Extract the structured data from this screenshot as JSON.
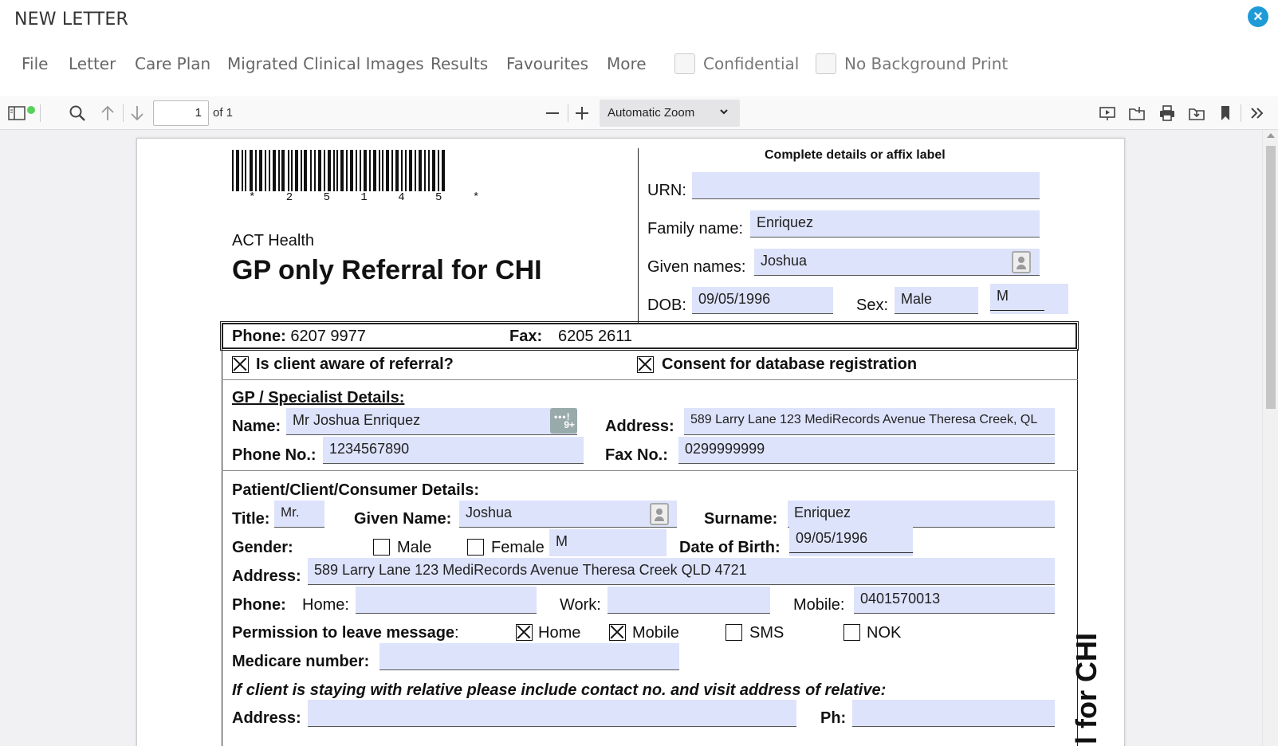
{
  "window": {
    "title": "NEW LETTER"
  },
  "menu": {
    "items": [
      "File",
      "Letter",
      "Care Plan",
      "Migrated Clinical Images",
      "Results",
      "Favourites",
      "More"
    ],
    "confidential_label": "Confidential",
    "no_bg_print_label": "No Background Print"
  },
  "pdf_toolbar": {
    "page_current": "1",
    "page_of": "of 1",
    "zoom": "Automatic Zoom"
  },
  "doc": {
    "barcode_text": "* 2 5 1 4 5 *",
    "org": "ACT Health",
    "title": "GP only Referral for CHI",
    "vertical_title": "l for CHI",
    "label_heading": "Complete details or affix label",
    "urn_label": "URN:",
    "urn_value": "",
    "family_name_label": "Family name:",
    "family_name_value": "Enriquez",
    "given_names_label": "Given names:",
    "given_names_value": "Joshua",
    "dob_label": "DOB:",
    "dob_value": "09/05/1996",
    "sex_label": "Sex:",
    "sex_value": "Male",
    "sex_code": "M",
    "phone_label": "Phone:",
    "phone_value": "6207 9977",
    "fax_label": "Fax:",
    "fax_value": "6205 2611",
    "aware_label": "Is client aware of referral?",
    "consent_label": "Consent for database registration",
    "gp_heading": "GP / Specialist Details:",
    "gp_name_label": "Name:",
    "gp_name_value": "Mr Joshua Enriquez",
    "gp_badge": "9+",
    "gp_address_label": "Address:",
    "gp_address_value": "589 Larry Lane 123 MediRecords Avenue Theresa Creek, QL",
    "gp_phone_label": "Phone No.:",
    "gp_phone_value": "1234567890",
    "gp_fax_label": "Fax No.:",
    "gp_fax_value": "0299999999",
    "patient_heading": "Patient/Client/Consumer Details:",
    "title_label": "Title:",
    "title_value": "Mr.",
    "given_name_label": "Given Name:",
    "given_name_value": "Joshua",
    "surname_label": "Surname:",
    "surname_value": "Enriquez",
    "gender_label": "Gender:",
    "male_label": "Male",
    "female_label": "Female",
    "gender_value": "M",
    "dob2_label": "Date of Birth:",
    "dob2_value": "09/05/1996",
    "address_label": "Address:",
    "address_value": "589 Larry Lane 123 MediRecords Avenue Theresa Creek QLD 4721",
    "phone2_label": "Phone:",
    "home_label": "Home:",
    "home_value": "",
    "work_label": "Work:",
    "work_value": "",
    "mobile_label": "Mobile:",
    "mobile_value": "0401570013",
    "permission_label": "Permission to leave message",
    "perm_colon": ":",
    "perm_home": "Home",
    "perm_mobile": "Mobile",
    "perm_sms": "SMS",
    "perm_nok": "NOK",
    "medicare_label": "Medicare number:",
    "medicare_value": "",
    "relative_note": "If client is staying with relative please include contact no. and visit address of relative:",
    "rel_address_label": "Address:",
    "rel_address_value": "",
    "rel_ph_label": "Ph:",
    "rel_ph_value": ""
  },
  "colors": {
    "accent": "#1e9bd7",
    "field_bg": "#dde3fb"
  }
}
